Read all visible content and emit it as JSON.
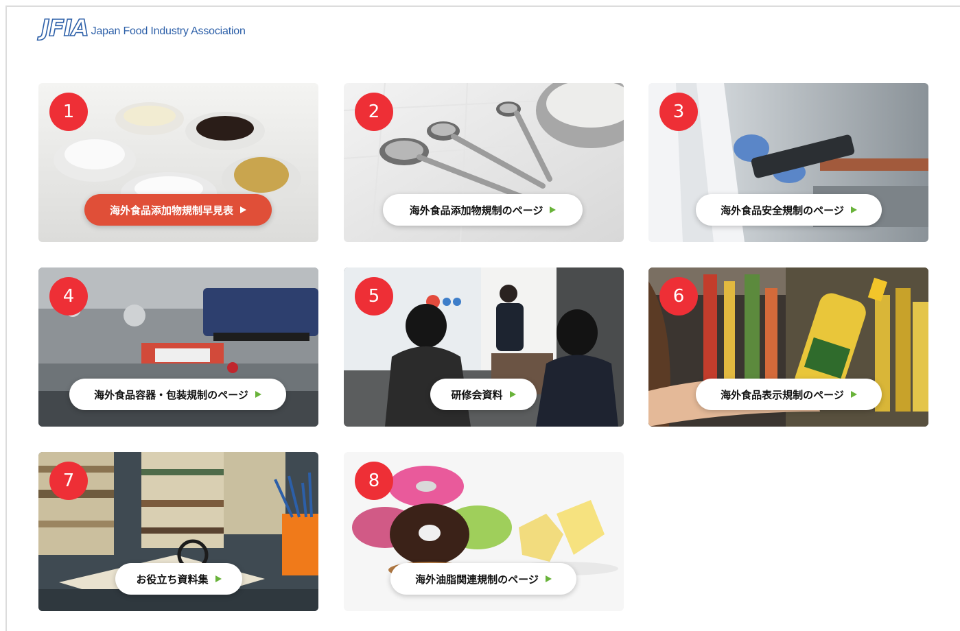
{
  "header": {
    "logo_mark": "JFIA",
    "logo_text": "Japan Food Industry Association"
  },
  "colors": {
    "badge": "#ee2f36",
    "highlight_pill": "#e04f38",
    "arrow": "#69b33a",
    "logo": "#2c5fa8"
  },
  "cards": [
    {
      "number": "1",
      "label": "海外食品添加物規制早見表",
      "image": "seasonings-in-bowls"
    },
    {
      "number": "2",
      "label": "海外食品添加物規制のページ",
      "image": "measuring-spoons"
    },
    {
      "number": "3",
      "label": "海外食品安全規制のページ",
      "image": "lab-worker-with-tablet"
    },
    {
      "number": "4",
      "label": "海外食品容器・包装規制のページ",
      "image": "packaging-machine"
    },
    {
      "number": "5",
      "label": "研修会資料",
      "image": "seminar-presentation"
    },
    {
      "number": "6",
      "label": "海外食品表示規制のページ",
      "image": "shopper-holding-oil-bottle"
    },
    {
      "number": "7",
      "label": "お役立ち資料集",
      "image": "stacked-books"
    },
    {
      "number": "8",
      "label": "海外油脂関連規制のページ",
      "image": "donuts-and-butter"
    }
  ]
}
